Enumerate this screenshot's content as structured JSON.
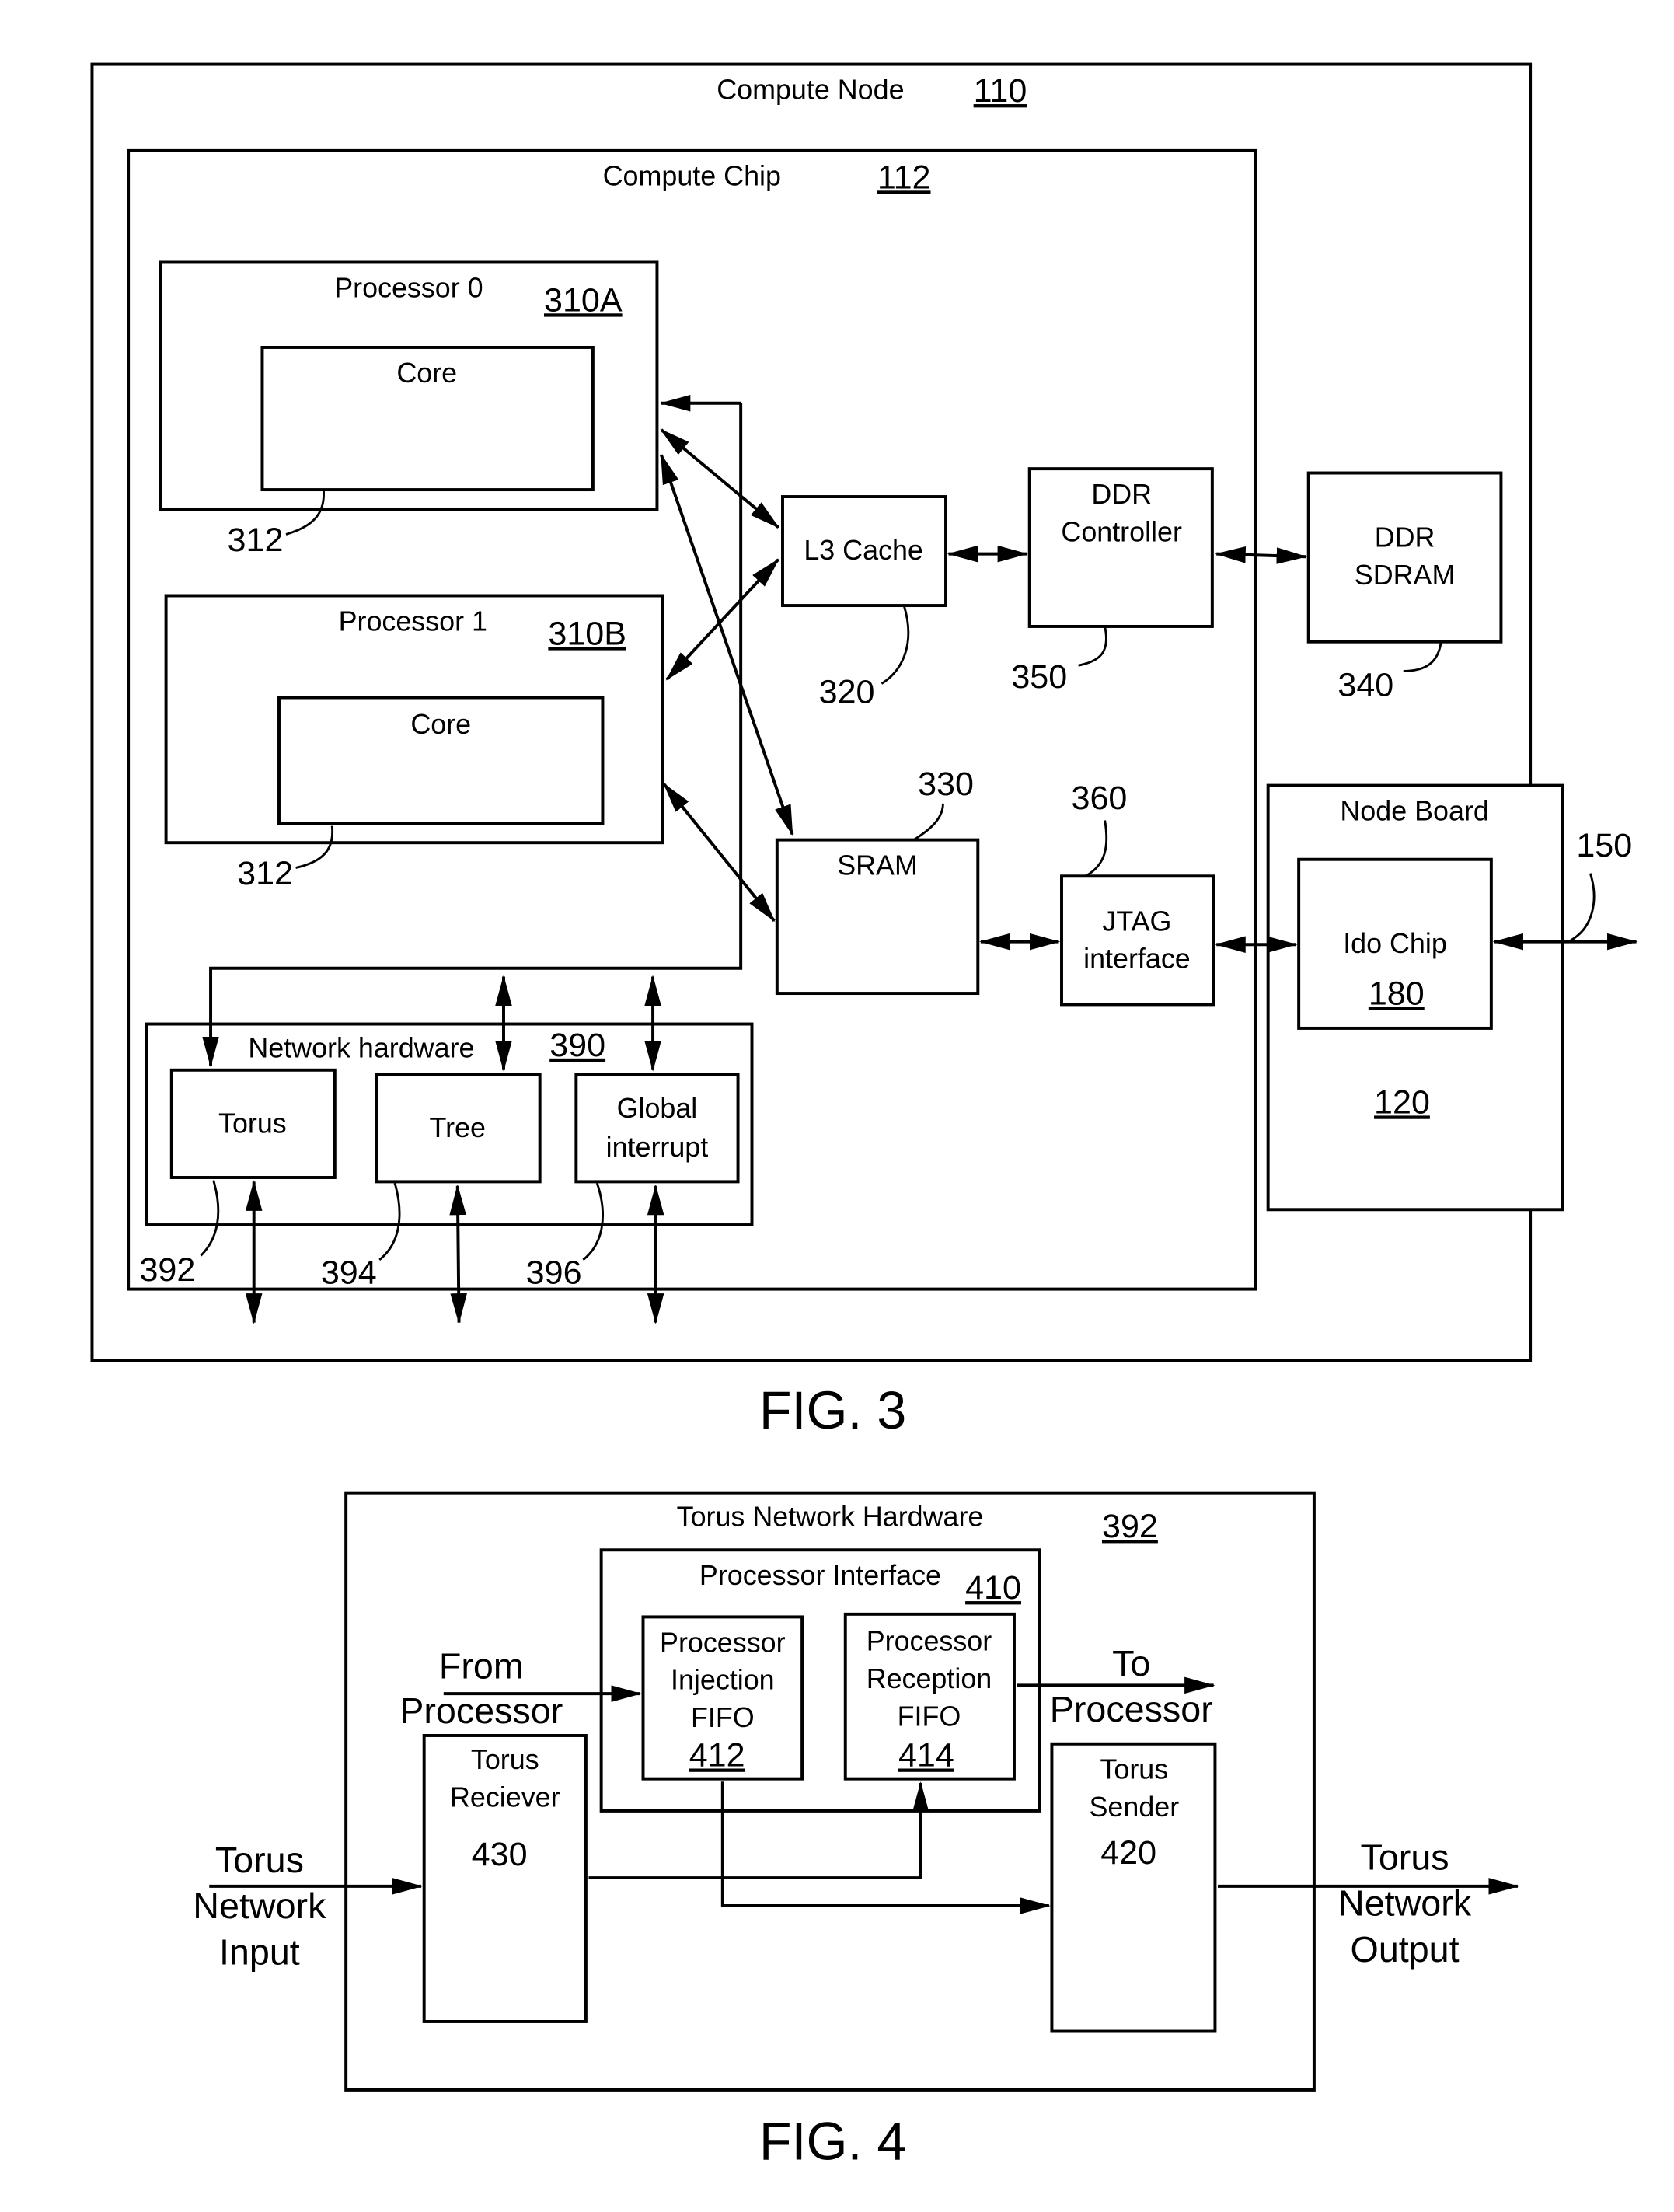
{
  "fig3": {
    "caption": "FIG. 3",
    "compute_node": {
      "label": "Compute Node",
      "ref": "110"
    },
    "compute_chip": {
      "label": "Compute Chip",
      "ref": "112"
    },
    "processor0": {
      "label": "Processor 0",
      "ref": "310A",
      "core_label": "Core",
      "core_ref": "312"
    },
    "processor1": {
      "label": "Processor 1",
      "ref": "310B",
      "core_label": "Core",
      "core_ref": "312"
    },
    "l3_cache": {
      "label": "L3 Cache",
      "ref": "320"
    },
    "ddr_controller": {
      "label_line1": "DDR",
      "label_line2": "Controller",
      "ref": "350"
    },
    "ddr_sdram": {
      "label_line1": "DDR",
      "label_line2": "SDRAM",
      "ref": "340"
    },
    "sram": {
      "label": "SRAM",
      "ref": "330"
    },
    "jtag": {
      "label_line1": "JTAG",
      "label_line2": "interface",
      "ref": "360"
    },
    "node_board": {
      "label": "Node Board",
      "ref": "120"
    },
    "ido_chip": {
      "label": "Ido Chip",
      "ref": "180"
    },
    "external_link_ref": "150",
    "network_hardware": {
      "label": "Network hardware",
      "ref": "390"
    },
    "torus": {
      "label": "Torus",
      "ref": "392"
    },
    "tree": {
      "label": "Tree",
      "ref": "394"
    },
    "global_interrupt": {
      "label_line1": "Global",
      "label_line2": "interrupt",
      "ref": "396"
    }
  },
  "fig4": {
    "caption": "FIG. 4",
    "torus_network_hardware": {
      "label": "Torus Network Hardware",
      "ref": "392"
    },
    "processor_interface": {
      "label": "Processor Interface",
      "ref": "410"
    },
    "injection_fifo": {
      "line1": "Processor",
      "line2": "Injection",
      "line3": "FIFO",
      "ref": "412"
    },
    "reception_fifo": {
      "line1": "Processor",
      "line2": "Reception",
      "line3": "FIFO",
      "ref": "414"
    },
    "from_processor": {
      "line1": "From",
      "line2": "Processor"
    },
    "to_processor": {
      "line1": "To",
      "line2": "Processor"
    },
    "torus_receiver": {
      "line1": "Torus",
      "line2": "Reciever",
      "ref": "430"
    },
    "torus_sender": {
      "line1": "Torus",
      "line2": "Sender",
      "ref": "420"
    },
    "network_input": {
      "line1": "Torus",
      "line2": "Network",
      "line3": "Input"
    },
    "network_output": {
      "line1": "Torus",
      "line2": "Network",
      "line3": "Output"
    }
  }
}
